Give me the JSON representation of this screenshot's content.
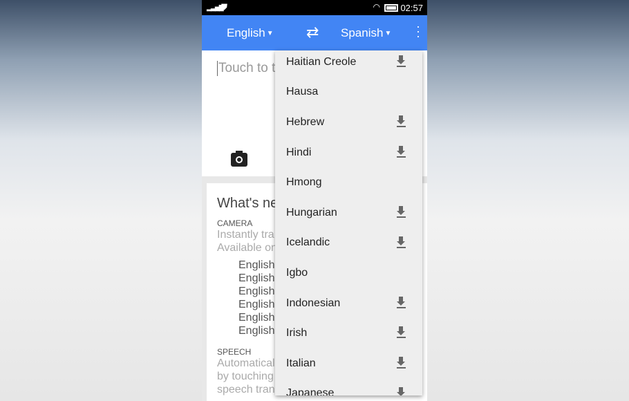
{
  "status": {
    "time": "02:57"
  },
  "header": {
    "source": "English",
    "target": "Spanish"
  },
  "input": {
    "placeholder": "Touch to t"
  },
  "card": {
    "title": "What's ne",
    "camera": "CAMERA",
    "camera_desc": [
      "Instantly tra",
      "Available on"
    ],
    "examples": [
      "English",
      "English",
      "English",
      "English",
      "English",
      "English"
    ],
    "speech": "SPEECH",
    "speech_desc": [
      "Automatical",
      "by touching",
      "speech translation."
    ]
  },
  "menu": {
    "items": [
      {
        "label": "Haitian Creole",
        "download": true
      },
      {
        "label": "Hausa",
        "download": false
      },
      {
        "label": "Hebrew",
        "download": true
      },
      {
        "label": "Hindi",
        "download": true
      },
      {
        "label": "Hmong",
        "download": false
      },
      {
        "label": "Hungarian",
        "download": true
      },
      {
        "label": "Icelandic",
        "download": true
      },
      {
        "label": "Igbo",
        "download": false
      },
      {
        "label": "Indonesian",
        "download": true
      },
      {
        "label": "Irish",
        "download": true
      },
      {
        "label": "Italian",
        "download": true
      },
      {
        "label": "Japanese",
        "download": true
      }
    ]
  },
  "colors": {
    "accent": "#4285f4"
  }
}
